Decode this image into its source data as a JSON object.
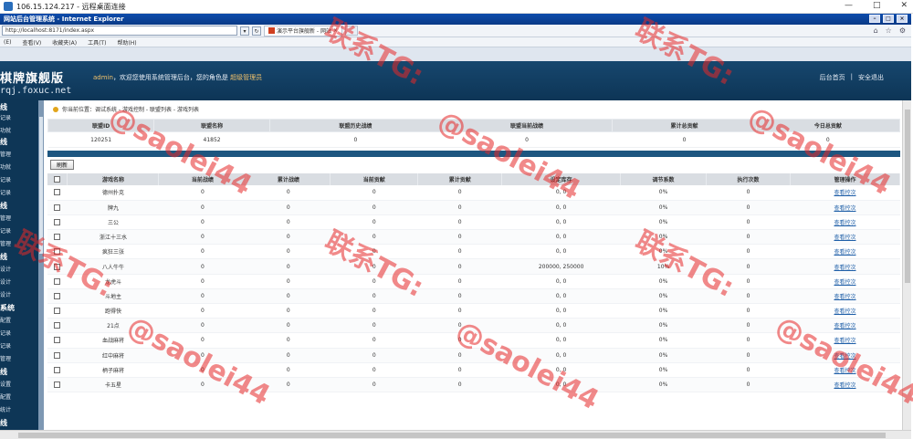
{
  "rdp": {
    "title": "106.15.124.217 - 远程桌面连接",
    "min": "—",
    "max": "□",
    "close": "✕"
  },
  "ie": {
    "title": "网站后台管理系统 - Internet Explorer",
    "address": "http://localhost:8171/index.aspx",
    "tab_label": "演示平台旗舰新 - 网站",
    "menu": [
      "(E)",
      "查看(V)",
      "收藏夹(A)",
      "工具(T)",
      "帮助(H)"
    ],
    "tools": [
      "⌂",
      "☆",
      "⚙"
    ]
  },
  "header": {
    "logo": "棋牌旗舰版",
    "logo_sub": "rqj.foxuc.net",
    "welcome_user": "admin",
    "welcome_text": "，欢迎您使用系统管理后台，您的角色是",
    "role": "超级管理员",
    "link_home": "后台首页",
    "link_sep": "|",
    "link_logout": "安全退出"
  },
  "sidebar": {
    "items": [
      "线",
      "记录",
      "功就",
      "线",
      "管理",
      "功就",
      "记录",
      "记录",
      "线",
      "管理",
      "记录",
      "管理",
      "线",
      "设计",
      "设计",
      "设计",
      "系统",
      "配置",
      "记录",
      "记录",
      "管理",
      "线",
      "设置",
      "配置",
      "统计",
      "线"
    ]
  },
  "breadcrumb": "你当前位置：调试系统 - 游戏控制 - 联盟列表 - 游戏列表",
  "summary": {
    "headers": [
      "联盟ID",
      "联盟名称",
      "联盟历史战绩",
      "联盟当前战绩",
      "累计总贡献",
      "今日总贡献"
    ],
    "row": [
      "120251",
      "41852",
      "0",
      "0",
      "0",
      "0"
    ]
  },
  "refresh_label": "刷新",
  "games": {
    "headers": [
      "游戏名称",
      "当前战绩",
      "累计战绩",
      "当前贡献",
      "累计贡献",
      "设定库存",
      "调节系数",
      "执行次数",
      "管理操作"
    ],
    "action_label": "查看控次",
    "rows": [
      [
        "德州扑克",
        "0",
        "0",
        "0",
        "0",
        "0, 0",
        "0%",
        "0"
      ],
      [
        "牌九",
        "0",
        "0",
        "0",
        "0",
        "0, 0",
        "0%",
        "0"
      ],
      [
        "三公",
        "0",
        "0",
        "0",
        "0",
        "0, 0",
        "0%",
        "0"
      ],
      [
        "浙江十三水",
        "0",
        "0",
        "0",
        "0",
        "0, 0",
        "0%",
        "0"
      ],
      [
        "疯狂三张",
        "0",
        "0",
        "0",
        "0",
        "0, 0",
        "0%",
        "0"
      ],
      [
        "八人牛牛",
        "0",
        "0",
        "0",
        "0",
        "200000, 250000",
        "10%",
        "0"
      ],
      [
        "龙虎斗",
        "0",
        "0",
        "0",
        "0",
        "0, 0",
        "0%",
        "0"
      ],
      [
        "斗地主",
        "0",
        "0",
        "0",
        "0",
        "0, 0",
        "0%",
        "0"
      ],
      [
        "跑得快",
        "0",
        "0",
        "0",
        "0",
        "0, 0",
        "0%",
        "0"
      ],
      [
        "21点",
        "0",
        "0",
        "0",
        "0",
        "0, 0",
        "0%",
        "0"
      ],
      [
        "血战麻将",
        "0",
        "0",
        "0",
        "0",
        "0, 0",
        "0%",
        "0"
      ],
      [
        "红中麻将",
        "0",
        "0",
        "0",
        "0",
        "0, 0",
        "0%",
        "0"
      ],
      [
        "柄子麻将",
        "0",
        "0",
        "0",
        "0",
        "0, 0",
        "0%",
        "0"
      ],
      [
        "卡五星",
        "0",
        "0",
        "0",
        "0",
        "0, 0",
        "0%",
        "0"
      ]
    ]
  },
  "watermark": [
    "联系TG:",
    "@saolei44"
  ]
}
